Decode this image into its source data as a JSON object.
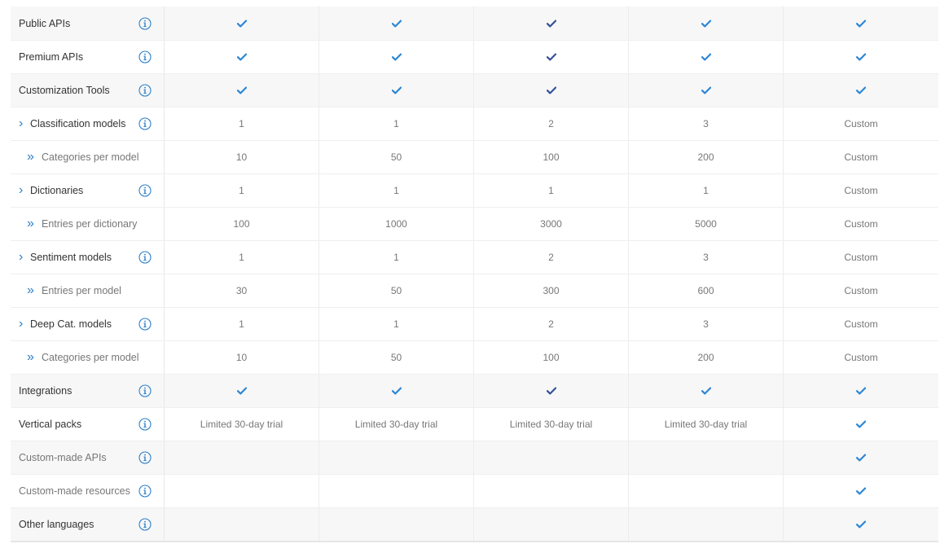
{
  "colors": {
    "check": "#2c86d6",
    "check_dark": "#34509a",
    "accent": "#2c7fc9"
  },
  "icons": {
    "info": "info-circle-icon",
    "check": "checkmark-icon",
    "expand": "chevron-right-icon",
    "sub": "double-chevron-right-icon"
  },
  "rows": [
    {
      "label": "Public APIs",
      "kind": "feature",
      "info": true,
      "shade": true,
      "cells": [
        "check",
        "check",
        "check-dark",
        "check",
        "check"
      ]
    },
    {
      "label": "Premium APIs",
      "kind": "feature",
      "info": true,
      "shade": false,
      "cells": [
        "check",
        "check",
        "check-dark",
        "check",
        "check"
      ]
    },
    {
      "label": "Customization Tools",
      "kind": "feature",
      "info": true,
      "shade": true,
      "cells": [
        "check",
        "check",
        "check-dark",
        "check",
        "check"
      ]
    },
    {
      "label": "Classification models",
      "kind": "expand",
      "info": true,
      "shade": false,
      "cells": [
        "1",
        "1",
        "2",
        "3",
        "Custom"
      ]
    },
    {
      "label": "Categories per model",
      "kind": "sub",
      "info": false,
      "shade": false,
      "cells": [
        "10",
        "50",
        "100",
        "200",
        "Custom"
      ]
    },
    {
      "label": "Dictionaries",
      "kind": "expand",
      "info": true,
      "shade": false,
      "cells": [
        "1",
        "1",
        "1",
        "1",
        "Custom"
      ]
    },
    {
      "label": "Entries per dictionary",
      "kind": "sub",
      "info": false,
      "shade": false,
      "cells": [
        "100",
        "1000",
        "3000",
        "5000",
        "Custom"
      ]
    },
    {
      "label": "Sentiment models",
      "kind": "expand",
      "info": true,
      "shade": false,
      "cells": [
        "1",
        "1",
        "2",
        "3",
        "Custom"
      ]
    },
    {
      "label": "Entries per model",
      "kind": "sub",
      "info": false,
      "shade": false,
      "cells": [
        "30",
        "50",
        "300",
        "600",
        "Custom"
      ]
    },
    {
      "label": "Deep Cat. models",
      "kind": "expand",
      "info": true,
      "shade": false,
      "cells": [
        "1",
        "1",
        "2",
        "3",
        "Custom"
      ]
    },
    {
      "label": "Categories per model",
      "kind": "sub",
      "info": false,
      "shade": false,
      "cells": [
        "10",
        "50",
        "100",
        "200",
        "Custom"
      ]
    },
    {
      "label": "Integrations",
      "kind": "feature",
      "info": true,
      "shade": true,
      "cells": [
        "check",
        "check",
        "check-dark",
        "check",
        "check"
      ]
    },
    {
      "label": "Vertical packs",
      "kind": "feature",
      "info": true,
      "shade": false,
      "cells": [
        "Limited 30-day trial",
        "Limited 30-day trial",
        "Limited 30-day trial",
        "Limited 30-day trial",
        "check"
      ]
    },
    {
      "label": "Custom-made APIs",
      "kind": "muted",
      "info": true,
      "shade": true,
      "cells": [
        "",
        "",
        "",
        "",
        "check"
      ]
    },
    {
      "label": "Custom-made resources",
      "kind": "muted",
      "info": true,
      "shade": false,
      "cells": [
        "",
        "",
        "",
        "",
        "check"
      ]
    },
    {
      "label": "Other languages",
      "kind": "feature",
      "info": true,
      "shade": true,
      "cells": [
        "",
        "",
        "",
        "",
        "check"
      ]
    }
  ]
}
